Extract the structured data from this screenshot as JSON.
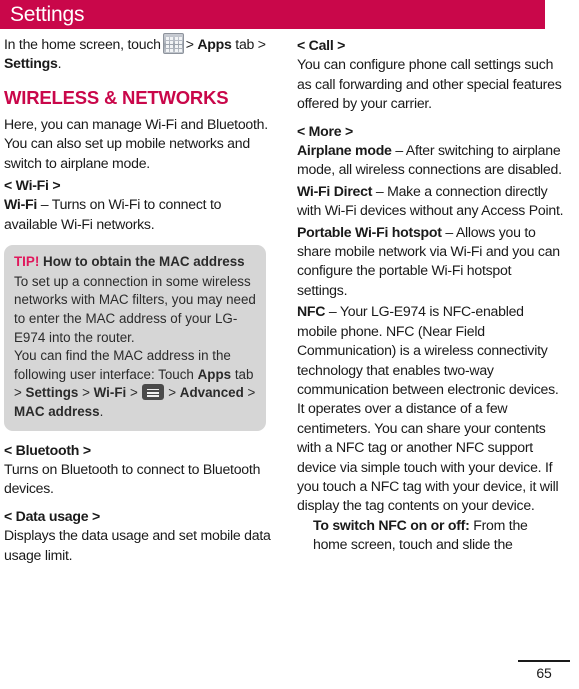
{
  "header": {
    "title": "Settings",
    "bar_color": "#c9074a"
  },
  "left_column": {
    "intro_1": "In the home screen, touch",
    "apps_icon_name": "apps-grid-icon",
    "intro_2": ">",
    "intro_apps": "Apps",
    "intro_3": "tab >",
    "intro_settings": "Settings",
    "intro_4": ".",
    "section_heading": "WIRELESS & NETWORKS",
    "section_intro": "Here, you can manage Wi-Fi and Bluetooth. You can also set up mobile networks and switch to airplane mode.",
    "wifi_heading": "< Wi-Fi >",
    "wifi_term": "Wi-Fi",
    "wifi_desc": " – Turns on Wi-Fi to connect to available Wi-Fi networks.",
    "tip": {
      "label": "TIP!",
      "title": " How to obtain the MAC address",
      "para1": "To set up a connection in some wireless networks with MAC filters, you may need to enter the MAC address of your LG-E974 into the router.",
      "para2_a": "You can find the MAC address in the following user interface: Touch ",
      "apps_bold": "Apps",
      "para2_b": " tab > ",
      "settings_bold": "Settings",
      "para2_c": " > ",
      "wifi_bold": "Wi-Fi",
      "para2_d": " > ",
      "menu_icon_name": "menu-icon",
      "para2_e": " > ",
      "advanced_bold": "Advanced",
      "para2_f": " > ",
      "mac_bold": "MAC address",
      "para2_g": "."
    },
    "bluetooth_heading": "< Bluetooth >",
    "bluetooth_desc": "Turns on Bluetooth to connect to Bluetooth devices.",
    "data_usage_heading": "< Data usage >",
    "data_usage_desc": "Displays the data usage and set mobile data usage limit."
  },
  "right_column": {
    "call_heading": "< Call >",
    "call_desc": "You can configure phone call settings such as call forwarding and other special features offered by your carrier.",
    "more_heading": "< More >",
    "airplane_term": "Airplane mode",
    "airplane_desc": " – After switching to airplane mode, all wireless connections are disabled.",
    "wifi_direct_term": "Wi-Fi Direct",
    "wifi_direct_desc": " – Make a connection directly with Wi-Fi devices without any Access Point.",
    "hotspot_term": "Portable Wi-Fi hotspot",
    "hotspot_desc": " – Allows you to share mobile network via Wi-Fi and you can configure the portable Wi-Fi hotspot settings.",
    "nfc_term": "NFC",
    "nfc_desc": " – Your LG-E974 is NFC-enabled mobile phone. NFC (Near Field Communication) is a wireless connectivity technology that enables two-way communication between electronic devices. It operates over a distance of a few centimeters. You can share your contents with a NFC tag or another NFC support device via simple touch with your device. If you touch a NFC tag with your device, it will display the tag contents on your device.",
    "nfc_switch_term": "To switch NFC on or off:",
    "nfc_switch_desc": " From the home screen, touch and slide the"
  },
  "footer": {
    "page_number": "65"
  }
}
